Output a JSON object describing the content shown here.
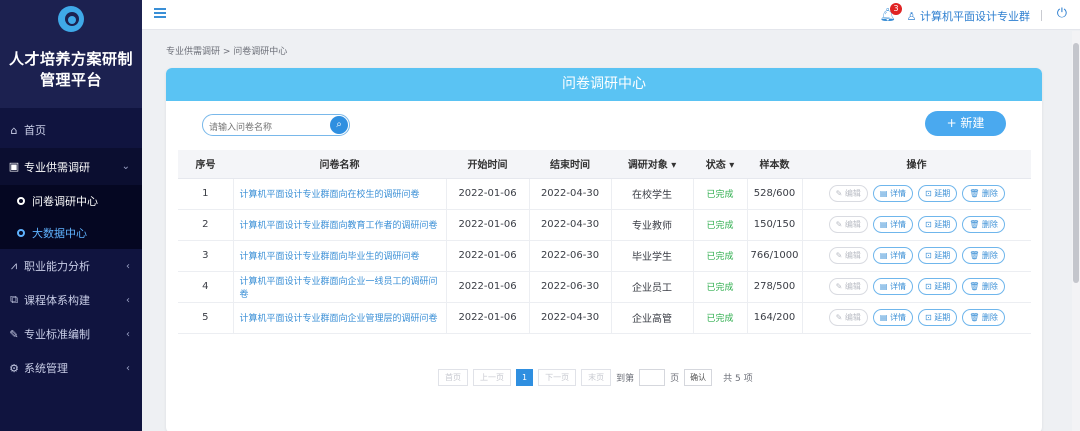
{
  "sidebar": {
    "app_title_line1": "人才培养方案研制",
    "app_title_line2": "管理平台",
    "logo_icon": "logo-swirl",
    "menu": [
      {
        "label": "首页",
        "icon": "home-icon"
      },
      {
        "label": "专业供需调研",
        "icon": "survey-icon",
        "expanded": true,
        "arrow": "⌄"
      },
      {
        "label": "职业能力分析",
        "icon": "chart-icon",
        "arrow": "‹"
      },
      {
        "label": "课程体系构建",
        "icon": "tree-icon",
        "arrow": "‹"
      },
      {
        "label": "专业标准编制",
        "icon": "edit-icon",
        "arrow": "‹"
      },
      {
        "label": "系统管理",
        "icon": "gear-icon",
        "arrow": "‹"
      }
    ],
    "submenu": [
      {
        "label": "问卷调研中心",
        "active": true
      },
      {
        "label": "大数据中心"
      }
    ]
  },
  "topbar": {
    "notification_count": "3",
    "user_name": "计算机平面设计专业群"
  },
  "breadcrumb": "专业供需调研 > 问卷调研中心",
  "panel": {
    "title": "问卷调研中心",
    "search_placeholder": "请输入问卷名称",
    "new_button": "+ 新建"
  },
  "table": {
    "headers": {
      "no": "序号",
      "name": "问卷名称",
      "start": "开始时间",
      "end": "结束时间",
      "target": "调研对象 ▾",
      "status": "状态 ▾",
      "samples": "样本数",
      "ops": "操作"
    },
    "rows": [
      {
        "no": "1",
        "name": "计算机平面设计专业群面向在校生的调研问卷",
        "start": "2022-01-06",
        "end": "2022-04-30",
        "target": "在校学生",
        "status": "已完成",
        "samples": "528/600"
      },
      {
        "no": "2",
        "name": "计算机平面设计专业群面向教育工作者的调研问卷",
        "start": "2022-01-06",
        "end": "2022-04-30",
        "target": "专业教师",
        "status": "已完成",
        "samples": "150/150"
      },
      {
        "no": "3",
        "name": "计算机平面设计专业群面向毕业生的调研问卷",
        "start": "2022-01-06",
        "end": "2022-06-30",
        "target": "毕业学生",
        "status": "已完成",
        "samples": "766/1000"
      },
      {
        "no": "4",
        "name": "计算机平面设计专业群面向企业一线员工的调研问卷",
        "start": "2022-01-06",
        "end": "2022-06-30",
        "target": "企业员工",
        "status": "已完成",
        "samples": "278/500"
      },
      {
        "no": "5",
        "name": "计算机平面设计专业群面向企业管理层的调研问卷",
        "start": "2022-01-06",
        "end": "2022-04-30",
        "target": "企业高管",
        "status": "已完成",
        "samples": "164/200"
      }
    ],
    "op_labels": {
      "edit": "编辑",
      "detail": "详情",
      "extend": "延期",
      "delete": "删除"
    }
  },
  "pagination": {
    "first": "首页",
    "prev": "上一页",
    "current": "1",
    "next": "下一页",
    "last": "末页",
    "goto_prefix": "到第",
    "goto_suffix": "页",
    "confirm": "确认",
    "total": "共 5 项"
  }
}
